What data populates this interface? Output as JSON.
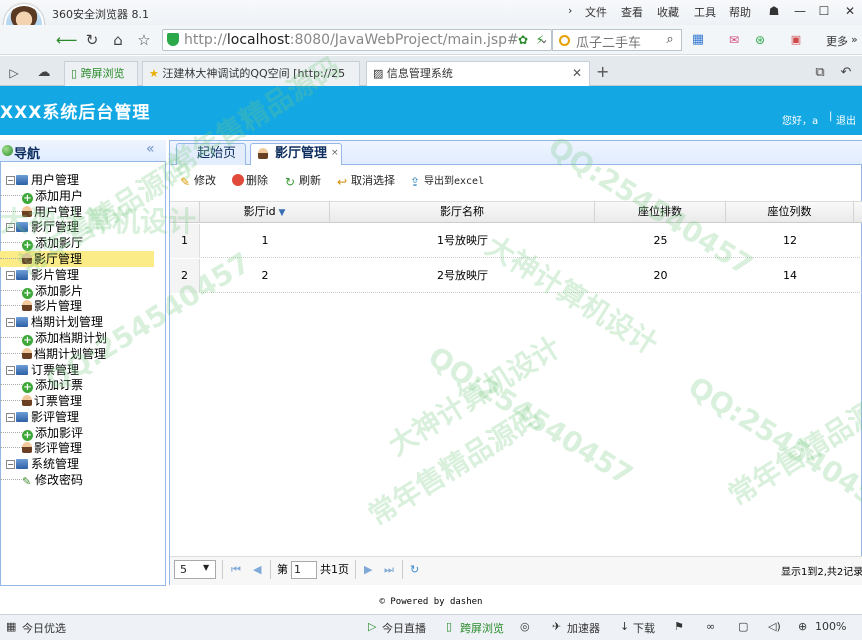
{
  "browser": {
    "name": "360安全浏览器 8.1",
    "menus": [
      "文件",
      "查看",
      "收藏",
      "工具",
      "帮助"
    ],
    "url_prefix": "http://",
    "url_host": "localhost",
    "url_rest": ":8080/JavaWebProject/main.jsp#",
    "search_text": "瓜子二手车",
    "more_label": "更多",
    "tabs": [
      "跨屏浏览",
      "汪建林大神调试的QQ空间 [http://25",
      "信息管理系统"
    ],
    "status_left": "今日优选",
    "status_items": [
      "今日直播",
      "跨屏浏览",
      "加速器",
      "下载"
    ],
    "zoom": "100%"
  },
  "app": {
    "title": "XXX系统后台管理",
    "greeting": "您好，a",
    "logout": "退出"
  },
  "nav": {
    "title": "导航",
    "tree": [
      {
        "label": "用户管理",
        "type": "folder"
      },
      {
        "label": "添加用户",
        "type": "add"
      },
      {
        "label": "用户管理",
        "type": "user"
      },
      {
        "label": "影厅管理",
        "type": "folder"
      },
      {
        "label": "添加影厅",
        "type": "add"
      },
      {
        "label": "影厅管理",
        "type": "user",
        "selected": true
      },
      {
        "label": "影片管理",
        "type": "folder"
      },
      {
        "label": "添加影片",
        "type": "add"
      },
      {
        "label": "影片管理",
        "type": "user"
      },
      {
        "label": "档期计划管理",
        "type": "folder"
      },
      {
        "label": "添加档期计划",
        "type": "add"
      },
      {
        "label": "档期计划管理",
        "type": "user"
      },
      {
        "label": "订票管理",
        "type": "folder"
      },
      {
        "label": "添加订票",
        "type": "add"
      },
      {
        "label": "订票管理",
        "type": "user"
      },
      {
        "label": "影评管理",
        "type": "folder"
      },
      {
        "label": "添加影评",
        "type": "add"
      },
      {
        "label": "影评管理",
        "type": "user"
      },
      {
        "label": "系统管理",
        "type": "folder"
      },
      {
        "label": "修改密码",
        "type": "pen"
      }
    ]
  },
  "center": {
    "tabs": [
      "起始页",
      "影厅管理"
    ],
    "toolbar": [
      "修改",
      "删除",
      "刷新",
      "取消选择",
      "导出到excel"
    ],
    "columns": [
      "影厅id",
      "影厅名称",
      "座位排数",
      "座位列数"
    ],
    "rows": [
      {
        "num": "1",
        "id": "1",
        "name": "1号放映厅",
        "rows": "25",
        "cols": "12"
      },
      {
        "num": "2",
        "id": "2",
        "name": "2号放映厅",
        "rows": "20",
        "cols": "14"
      }
    ],
    "pager": {
      "page_size": "5",
      "page_label_pre": "第",
      "page_value": "1",
      "page_label_post": "共1页",
      "info": "显示1到2,共2记录"
    }
  },
  "footer": {
    "text": "© Powered by dashen"
  },
  "watermark": [
    "常年售精品源码",
    "QQ:254540457",
    "大神计算机设计"
  ]
}
